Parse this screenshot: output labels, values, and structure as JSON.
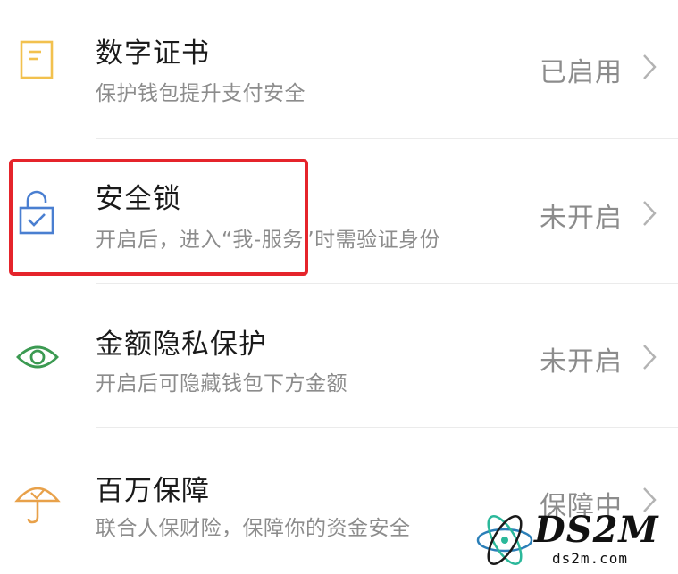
{
  "security_list": {
    "items": [
      {
        "title": "数字证书",
        "subtitle": "保护钱包提升支付安全",
        "status": "已启用",
        "icon": "certificate-icon",
        "icon_color": "#f2c14e"
      },
      {
        "title": "安全锁",
        "subtitle": "开启后，进入“我-服务”时需验证身份",
        "status": "未开启",
        "icon": "lock-icon",
        "icon_color": "#4a7fd1"
      },
      {
        "title": "金额隐私保护",
        "subtitle": "开启后可隐藏钱包下方金额",
        "status": "未开启",
        "icon": "eye-icon",
        "icon_color": "#3c9a52"
      },
      {
        "title": "百万保障",
        "subtitle": "联合人保财险，保障你的资金安全",
        "status": "保障中",
        "icon": "umbrella-icon",
        "icon_color": "#e8a14a"
      }
    ]
  },
  "highlight": {
    "color": "#e5242b"
  },
  "watermark": {
    "logo": "DS2M",
    "site": "ds2m.com"
  }
}
